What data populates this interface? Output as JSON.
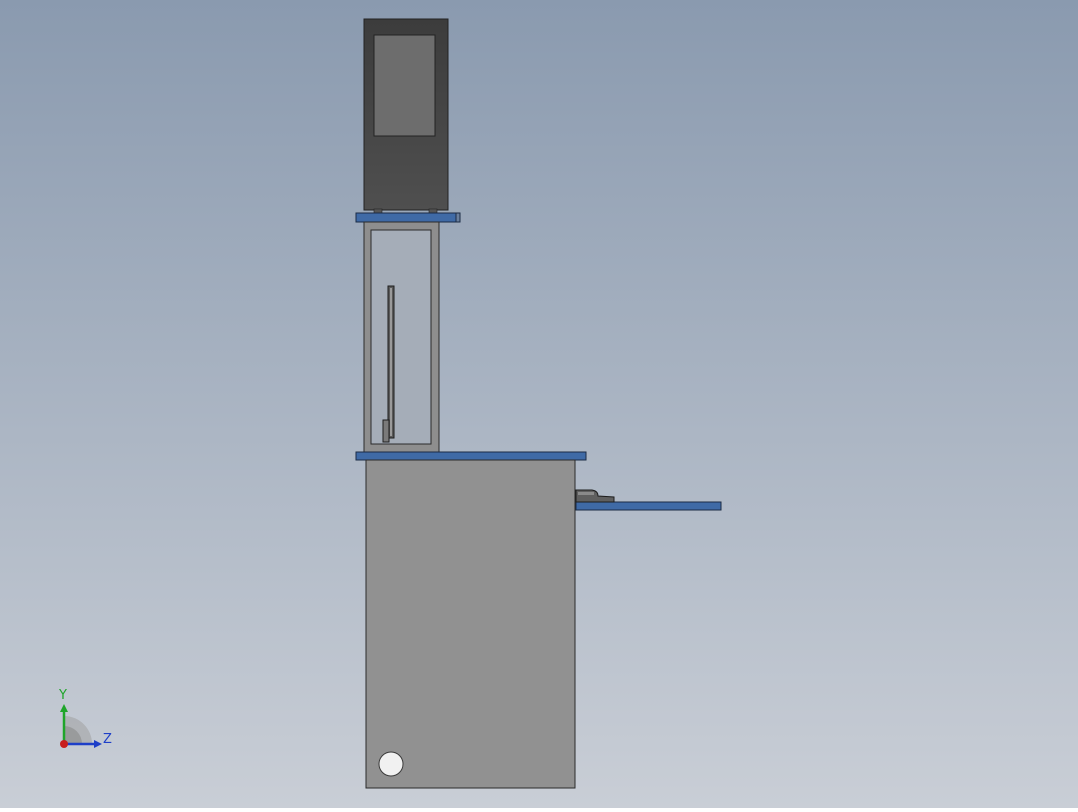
{
  "viewport": {
    "background_top": "#8a9aaf",
    "background_bottom": "#c9ced6"
  },
  "colors": {
    "cabinet_body": "#919191",
    "panel_blue": "#3f6aa6",
    "monitor_housing": "#4b4b4b",
    "monitor_screen": "#6d6d6d",
    "frame_grey": "#8e8e8e",
    "outline": "#2b2b2b"
  },
  "axis_triad": {
    "y_label": "Y",
    "z_label": "Z",
    "y_color": "#1fa52a",
    "z_color": "#1e3fc8",
    "x_color": "#c81e1e",
    "icon": "coordinate-triad-icon"
  }
}
